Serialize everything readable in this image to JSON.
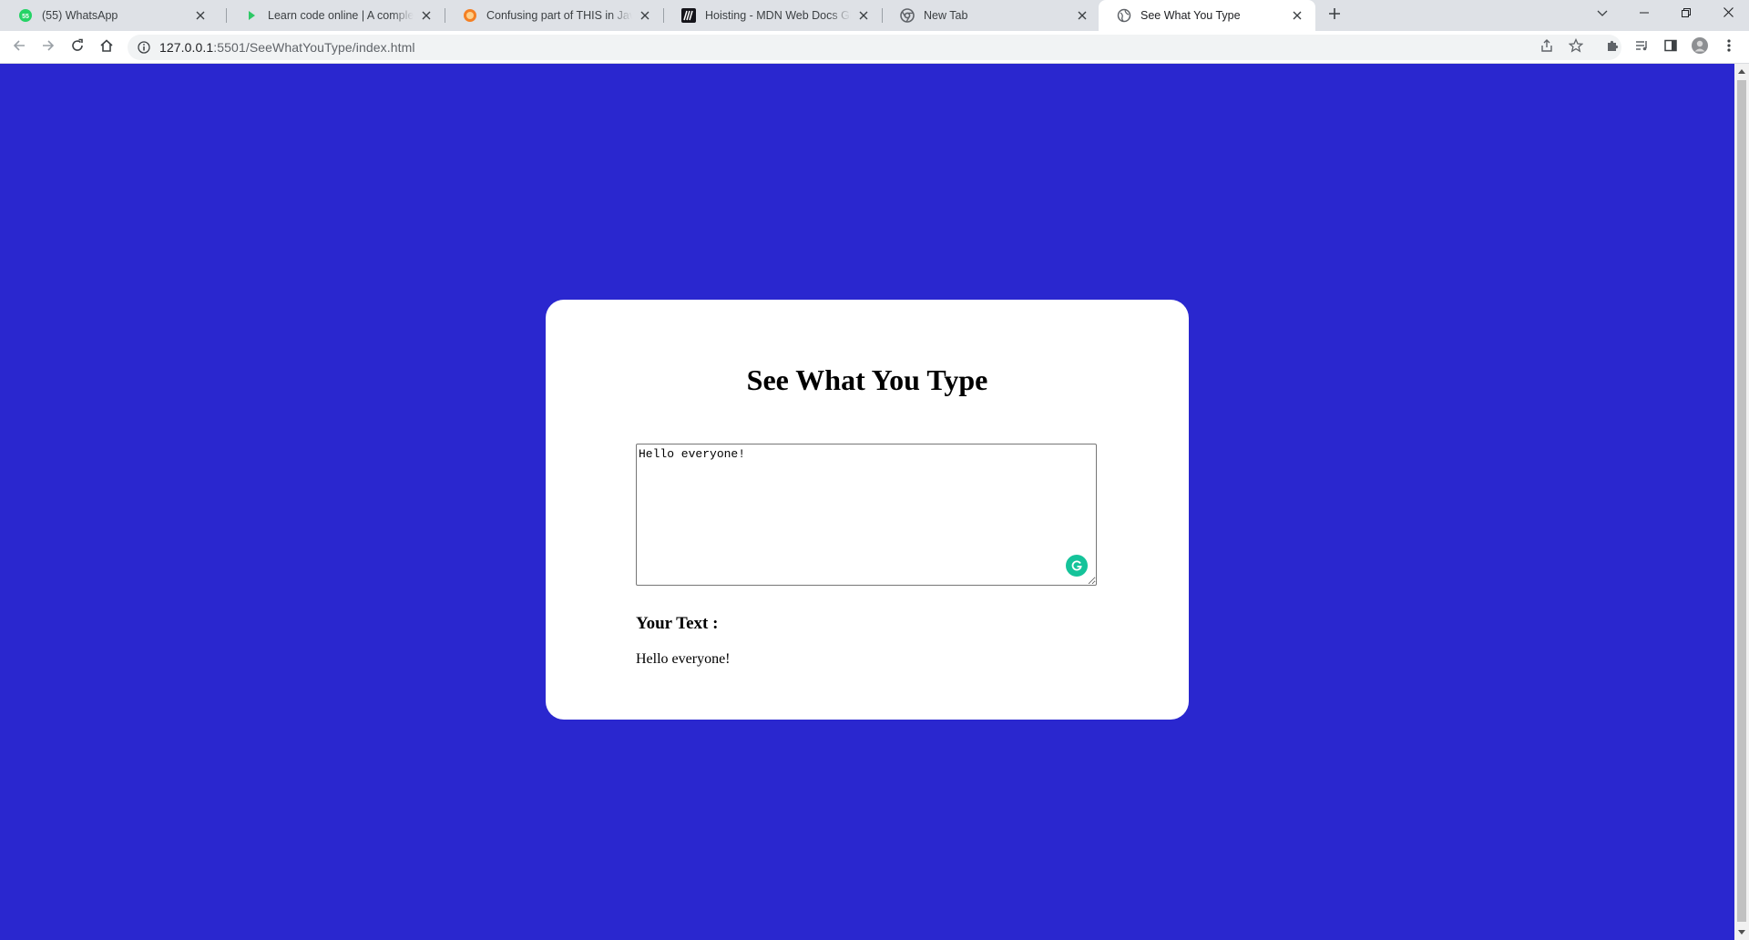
{
  "browser": {
    "tabs": [
      {
        "title": "(55) WhatsApp",
        "favicon": "whatsapp-icon",
        "active": false
      },
      {
        "title": "Learn code online | A complete platform",
        "favicon": "play-icon",
        "active": false
      },
      {
        "title": "Confusing part of THIS in JavaScript",
        "favicon": "stackoverflow-icon",
        "active": false
      },
      {
        "title": "Hoisting - MDN Web Docs Glossary",
        "favicon": "mdn-icon",
        "active": false
      },
      {
        "title": "New Tab",
        "favicon": "chrome-icon",
        "active": false
      },
      {
        "title": "See What You Type",
        "favicon": "globe-icon",
        "active": true
      }
    ],
    "whatsapp_badge": "55",
    "address": {
      "host": "127.0.0.1",
      "path": ":5501/SeeWhatYouType/index.html"
    },
    "colors": {
      "tabstrip": "#dee1e6",
      "page_background": "#2a27cf",
      "card": "#ffffff",
      "grammarly": "#15c39a"
    }
  },
  "page": {
    "heading": "See What You Type",
    "textarea_value": "Hello everyone!",
    "output_label": "Your Text :",
    "output_text": "Hello everyone!"
  }
}
